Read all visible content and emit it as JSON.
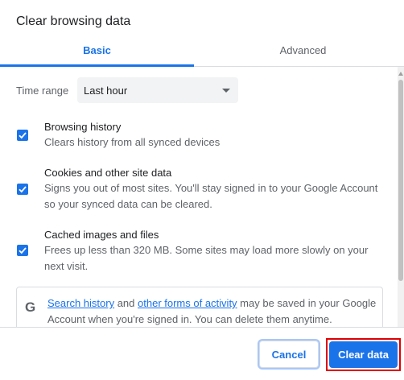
{
  "dialog": {
    "title": "Clear browsing data"
  },
  "tabs": [
    {
      "label": "Basic",
      "active": true
    },
    {
      "label": "Advanced",
      "active": false
    }
  ],
  "time_range": {
    "label": "Time range",
    "value": "Last hour"
  },
  "options": [
    {
      "label": "Browsing history",
      "description": "Clears history from all synced devices",
      "checked": true
    },
    {
      "label": "Cookies and other site data",
      "description": "Signs you out of most sites. You'll stay signed in to your Google Account so your synced data can be cleared.",
      "checked": true
    },
    {
      "label": "Cached images and files",
      "description": "Frees up less than 320 MB. Some sites may load more slowly on your next visit.",
      "checked": true
    }
  ],
  "info": {
    "icon": "google-g-icon",
    "link1": "Search history",
    "and": " and ",
    "link2": "other forms of activity",
    "text": " may be saved in your Google Account when you're signed in. You can delete them anytime."
  },
  "footer": {
    "cancel_label": "Cancel",
    "clear_label": "Clear data"
  },
  "colors": {
    "accent": "#1a73e8",
    "highlight": "#e00000"
  }
}
